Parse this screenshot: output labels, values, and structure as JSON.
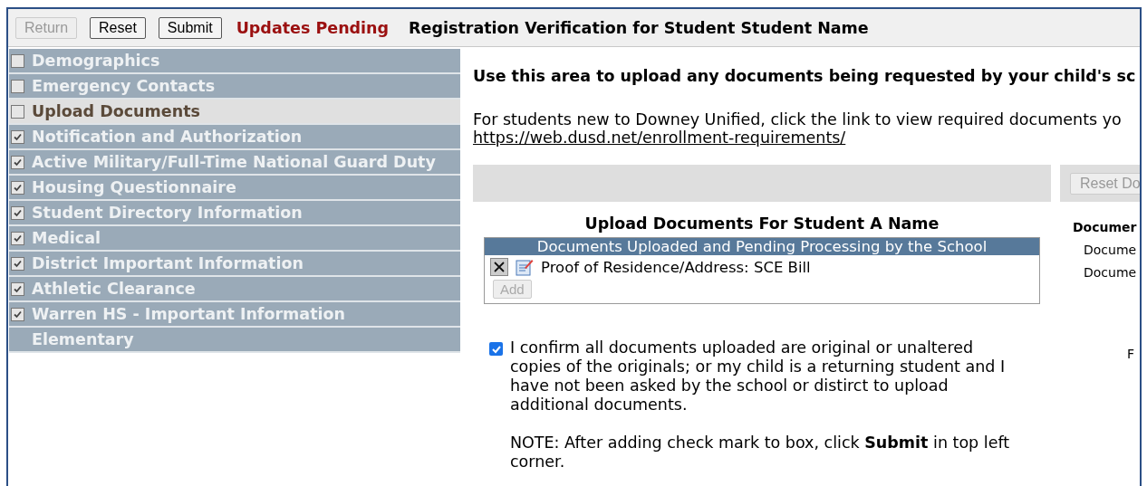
{
  "toolbar": {
    "buttons": [
      {
        "label": "Return",
        "disabled": true
      },
      {
        "label": "Reset",
        "disabled": false
      },
      {
        "label": "Submit",
        "disabled": false
      }
    ],
    "status": "Updates Pending",
    "title": "Registration Verification for Student Student Name"
  },
  "sidebar": {
    "items": [
      {
        "label": "Demographics",
        "kind": "checkbox",
        "checked": false,
        "selected": false
      },
      {
        "label": "Emergency Contacts",
        "kind": "checkbox",
        "checked": false,
        "selected": false
      },
      {
        "label": "Upload Documents",
        "kind": "checkbox",
        "checked": false,
        "selected": true
      },
      {
        "label": "Notification and Authorization",
        "kind": "checkbox",
        "checked": true,
        "selected": false
      },
      {
        "label": "Active Military/Full-Time National Guard Duty",
        "kind": "checkbox",
        "checked": true,
        "selected": false
      },
      {
        "label": "Housing Questionnaire",
        "kind": "checkbox",
        "checked": true,
        "selected": false
      },
      {
        "label": "Student Directory Information",
        "kind": "checkbox",
        "checked": true,
        "selected": false
      },
      {
        "label": "Medical",
        "kind": "checkbox",
        "checked": true,
        "selected": false
      },
      {
        "label": "District Important Information",
        "kind": "checkbox",
        "checked": true,
        "selected": false
      },
      {
        "label": "Athletic Clearance",
        "kind": "checkbox",
        "checked": true,
        "selected": false
      },
      {
        "label": "Warren HS - Important Information",
        "kind": "checkbox",
        "checked": true,
        "selected": false
      },
      {
        "label": "Elementary",
        "kind": "plain",
        "selected": false
      }
    ]
  },
  "content": {
    "heading": "Use this area to upload any documents being requested by your child's sc",
    "intro": "For students new to Downey Unified, click the link to view required documents yo",
    "link": "https://web.dusd.net/enrollment-requirements/",
    "upload": {
      "title": "Upload Documents For Student A Name",
      "table_header": "Documents Uploaded and Pending Processing by the School",
      "documents": [
        "Proof of Residence/Address: SCE Bill"
      ],
      "add_button": {
        "label": "Add",
        "disabled": true
      }
    },
    "confirm": {
      "checked": true,
      "text": "I confirm all documents uploaded are original or unaltered copies of the originals; or my child is a returning student and I have not been asked by the school or distirct to upload additional documents.",
      "note": "NOTE: After adding check mark to box, click **Submit** in top left corner."
    },
    "side_panel": {
      "button": {
        "label": "Reset Do",
        "disabled": true
      },
      "heading": "Documer",
      "lines": [
        "Docume",
        "Docume"
      ],
      "footer": "F"
    }
  }
}
